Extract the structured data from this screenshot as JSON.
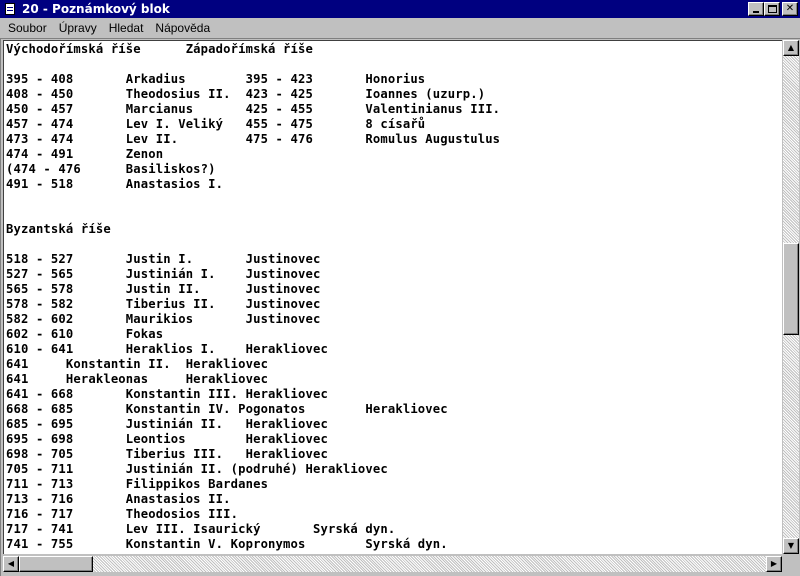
{
  "window": {
    "title": "20 - Poznámkový blok",
    "buttons": {
      "minimize_icon": "minimize-icon",
      "maximize_icon": "maximize-icon",
      "close_icon": "close-icon",
      "close_glyph": "✕"
    }
  },
  "menu": {
    "items": [
      {
        "label": "Soubor"
      },
      {
        "label": "Úpravy"
      },
      {
        "label": "Hledat"
      },
      {
        "label": "Nápověda"
      }
    ]
  },
  "document": {
    "lines": [
      "Východořímská říše      Západořímská říše",
      "",
      "395 - 408       Arkadius        395 - 423       Honorius",
      "408 - 450       Theodosius II.  423 - 425       Ioannes (uzurp.)",
      "450 - 457       Marcianus       425 - 455       Valentinianus III.",
      "457 - 474       Lev I. Veliký   455 - 475       8 císařů",
      "473 - 474       Lev II.         475 - 476       Romulus Augustulus",
      "474 - 491       Zenon",
      "(474 - 476      Basiliskos?)",
      "491 - 518       Anastasios I.",
      "",
      "",
      "Byzantská říše",
      "",
      "518 - 527       Justin I.       Justinovec",
      "527 - 565       Justinián I.    Justinovec",
      "565 - 578       Justin II.      Justinovec",
      "578 - 582       Tiberius II.    Justinovec",
      "582 - 602       Maurikios       Justinovec",
      "602 - 610       Fokas",
      "610 - 641       Heraklios I.    Herakliovec",
      "641     Konstantin II.  Herakliovec",
      "641     Herakleonas     Herakliovec",
      "641 - 668       Konstantin III. Herakliovec",
      "668 - 685       Konstantin IV. Pogonatos        Herakliovec",
      "685 - 695       Justinián II.   Herakliovec",
      "695 - 698       Leontios        Herakliovec",
      "698 - 705       Tiberius III.   Herakliovec",
      "705 - 711       Justinián II. (podruhé) Herakliovec",
      "711 - 713       Filippikos Bardanes",
      "713 - 716       Anastasios II.",
      "716 - 717       Theodosios III.",
      "717 - 741       Lev III. Isaurický       Syrská dyn.",
      "741 - 755       Konstantin V. Kopronymos        Syrská dyn."
    ]
  },
  "scrollbars": {
    "up_glyph": "▲",
    "down_glyph": "▼",
    "left_glyph": "◀",
    "right_glyph": "▶"
  }
}
